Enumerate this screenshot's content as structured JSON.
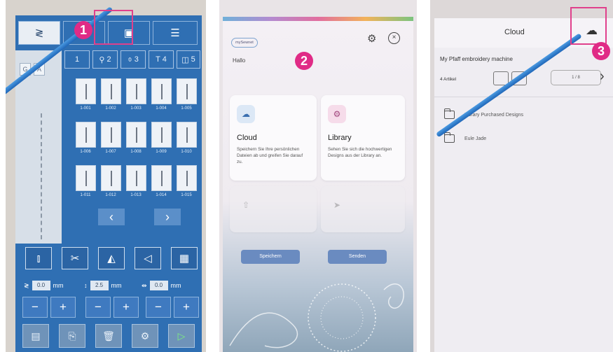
{
  "callouts": [
    "1",
    "2",
    "3"
  ],
  "panel1": {
    "top_tabs": [
      "stitch-tab",
      "cloud-tab",
      "embroidery-tab",
      "menu-tab"
    ],
    "category_tabs": [
      {
        "num": "1",
        "icon": "stitch-icon"
      },
      {
        "num": "2",
        "icon": "button-icon"
      },
      {
        "num": "3",
        "icon": "needle-icon"
      },
      {
        "num": "4",
        "icon": "text-icon"
      },
      {
        "num": "5",
        "icon": "shape-icon"
      }
    ],
    "stitch_codes": [
      "1-001",
      "1-002",
      "1-003",
      "1-004",
      "1-005",
      "1-006",
      "1-007",
      "1-008",
      "1-009",
      "1-010",
      "1-011",
      "1-012",
      "1-013",
      "1-014",
      "1-015"
    ],
    "width_value": "0.0",
    "length_value": "2.5",
    "position_value": "0.0",
    "unit": "mm",
    "side_labels": [
      "G",
      "A"
    ],
    "colors": {
      "screen": "#2f6fb3",
      "accent": "#e02b86"
    }
  },
  "panel2": {
    "logo": "mySewnet",
    "greeting": "Hallo",
    "cards": [
      {
        "title": "Cloud",
        "desc": "Speichern Sie Ihre persönlichen Dateien ab und greifen Sie darauf zu."
      },
      {
        "title": "Library",
        "desc": "Sehen Sie sich die hochwertigen Designs aus der Library an."
      }
    ],
    "buttons": {
      "save": "Speichern",
      "send": "Senden"
    }
  },
  "panel3": {
    "title": "Cloud",
    "machine": "My Pfaff embroidery machine",
    "items_count": "4 Artikel",
    "pager": "1 / 8",
    "files": [
      "Library Purchased Designs",
      "Eule Jade"
    ]
  }
}
